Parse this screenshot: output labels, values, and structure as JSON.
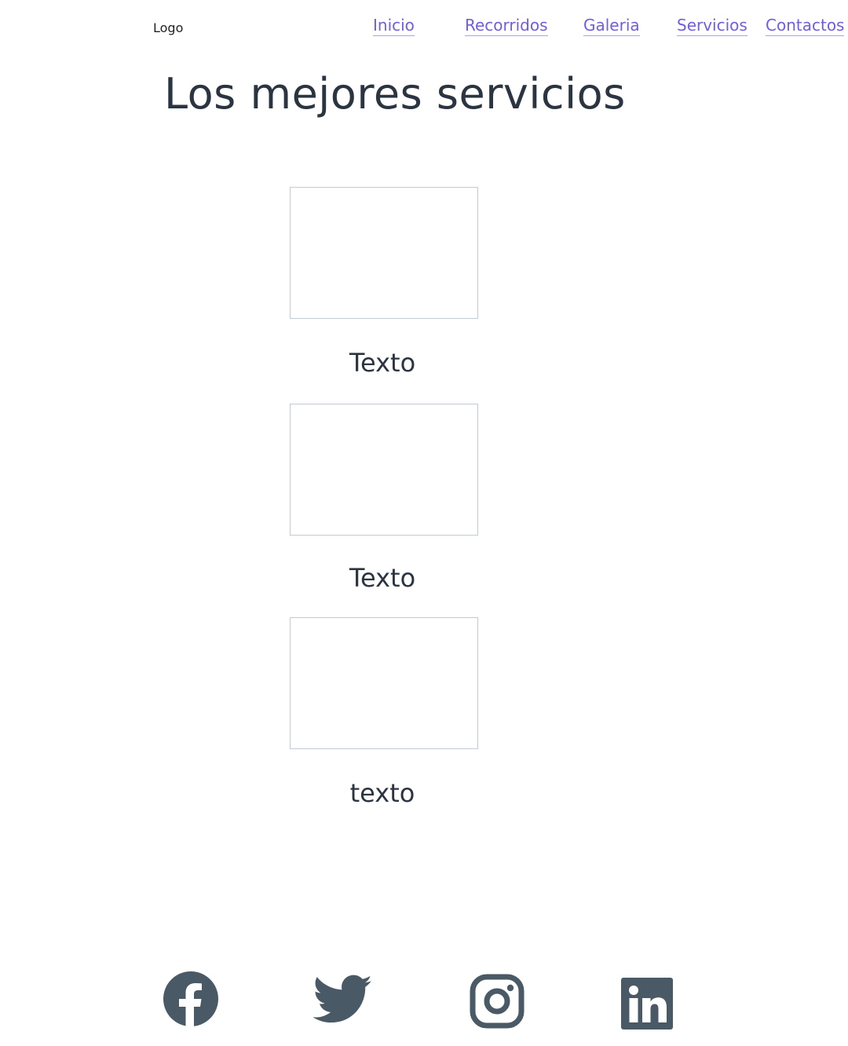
{
  "header": {
    "logo": "Logo",
    "nav": [
      {
        "label": "Inicio"
      },
      {
        "label": "Recorridos"
      },
      {
        "label": "Galeria"
      },
      {
        "label": "Servicios"
      },
      {
        "label": "Contactos"
      }
    ]
  },
  "main": {
    "title": "Los mejores servicios",
    "cards": [
      {
        "text": "Texto"
      },
      {
        "text": "Texto"
      },
      {
        "text": "texto"
      }
    ]
  },
  "footer": {
    "social_icons": [
      "facebook-icon",
      "twitter-icon",
      "instagram-icon",
      "linkedin-icon"
    ]
  },
  "colors": {
    "nav_link": "#6f5ee0",
    "text": "#2b3441",
    "icon": "#4a5966",
    "card_border": "#c3ccd6"
  }
}
